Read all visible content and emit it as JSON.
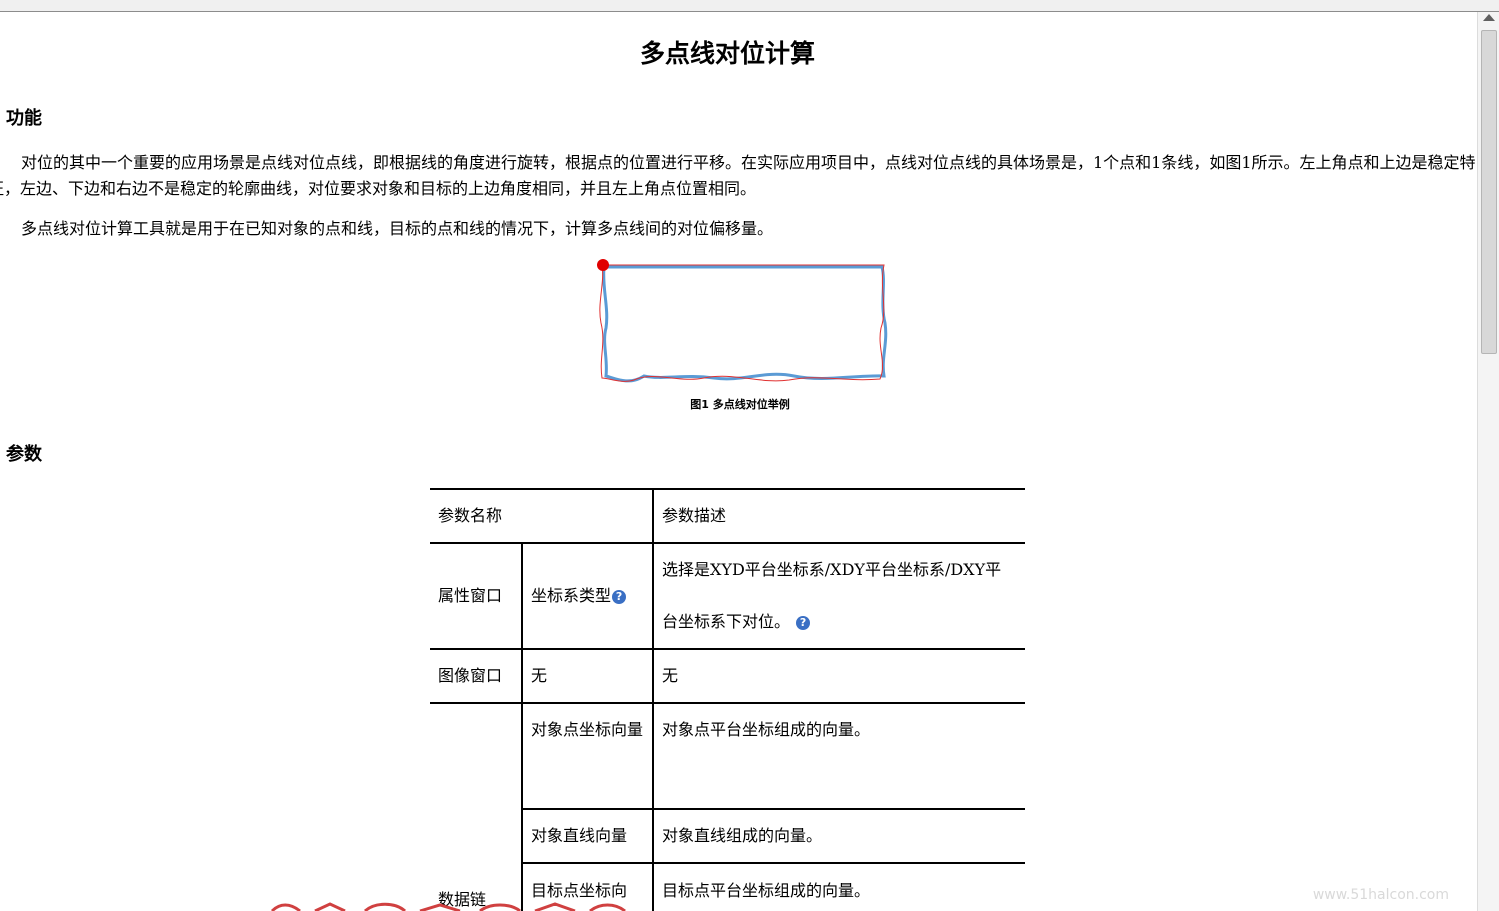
{
  "doc": {
    "title": "多点线对位计算",
    "section_function": "功能",
    "para1": "对位的其中一个重要的应用场景是点线对位点线，即根据线的角度进行旋转，根据点的位置进行平移。在实际应用项目中，点线对位点线的具体场景是，1个点和1条线，如图1所示。左上角点和上边是稳定特征，左边、下边和右边不是稳定的轮廓曲线，对位要求对象和目标的上边角度相同，并且左上角点位置相同。",
    "para2": "多点线对位计算工具就是用于在已知对象的点和线，目标的点和线的情况下，计算多点线间的对位偏移量。",
    "figure_caption": "图1  多点线对位举例",
    "section_params": "参数"
  },
  "table": {
    "header_name": "参数名称",
    "header_desc": "参数描述",
    "rows": [
      {
        "group": "属性窗口",
        "name": "坐标系类型",
        "desc": "选择是XYD平台坐标系/XDY平台坐标系/DXY平台坐标系下对位。"
      },
      {
        "group": "图像窗口",
        "name": "无",
        "desc": "无"
      },
      {
        "group": "数据链",
        "name": "对象点坐标向量",
        "desc": "对象点平台坐标组成的向量。"
      },
      {
        "name": "对象直线向量",
        "desc": "对象直线组成的向量。"
      },
      {
        "name": "目标点坐标向",
        "desc": "目标点平台坐标组成的向量。"
      }
    ]
  },
  "help_icon_glyph": "?",
  "watermark": "www.51halcon.com",
  "colors": {
    "object_outline": "#5b9bd5",
    "target_outline": "#e03030",
    "key_point": "#e00000",
    "help_icon": "#3a6fc4"
  }
}
